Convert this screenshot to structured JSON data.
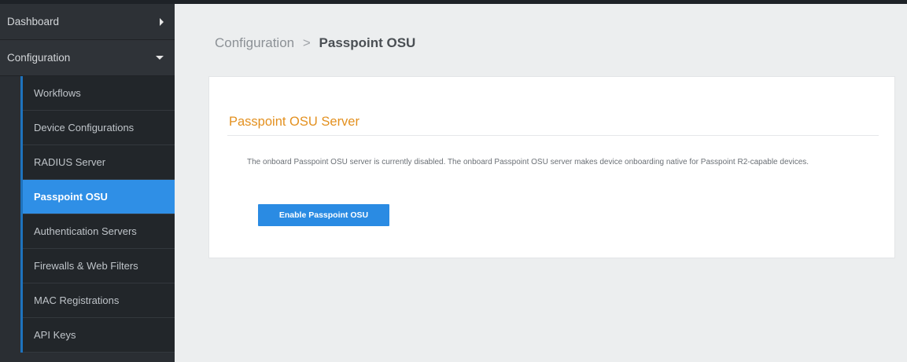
{
  "sidebar": {
    "dashboard_label": "Dashboard",
    "configuration_label": "Configuration",
    "items": [
      {
        "label": "Workflows"
      },
      {
        "label": "Device Configurations"
      },
      {
        "label": "RADIUS Server"
      },
      {
        "label": "Passpoint OSU",
        "active": true
      },
      {
        "label": "Authentication Servers"
      },
      {
        "label": "Firewalls & Web Filters"
      },
      {
        "label": "MAC Registrations"
      },
      {
        "label": "API Keys"
      }
    ]
  },
  "breadcrumb": {
    "parent": "Configuration",
    "separator": ">",
    "current": "Passpoint OSU"
  },
  "card": {
    "title": "Passpoint OSU Server",
    "description": "The onboard Passpoint OSU server is currently disabled. The onboard Passpoint OSU server makes device onboarding native for Passpoint R2-capable devices.",
    "enable_button_label": "Enable Passpoint OSU"
  },
  "icons": {
    "dashboard_caret": "caret-right-icon",
    "configuration_caret": "caret-down-icon"
  },
  "colors": {
    "accent": "#2a8be3",
    "title_orange": "#e3901f",
    "sidebar_bg": "#2a2e33"
  }
}
